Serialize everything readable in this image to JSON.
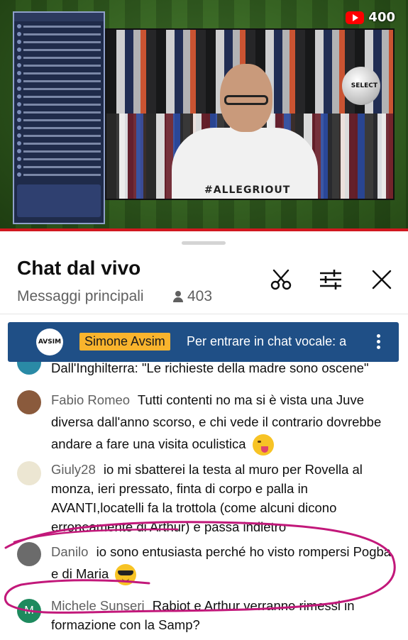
{
  "video": {
    "live_viewers_badge": "400",
    "shirt_text": "#ALLEGRIOUT",
    "ball_label": "SELECT"
  },
  "panel": {
    "title": "Chat dal vivo",
    "filter_label": "Messaggi principali",
    "viewer_count": "403",
    "icons": [
      "scissors-icon",
      "filter-sliders-icon",
      "close-icon"
    ]
  },
  "pinned": {
    "avatar_text": "AVSIM",
    "author": "Simone Avsim",
    "text": "Per entrare in chat vocale: a"
  },
  "messages": [
    {
      "author": "",
      "text": "Dall'Inghilterra: \"Le richieste della madre sono oscene\"",
      "avatar_color": "#2a8aa6"
    },
    {
      "author": "Fabio Romeo",
      "text": "Tutti contenti no ma si è vista una Juve diversa dall'anno scorso, e chi vede il contrario dovrebbe andare a fare una visita oculistica",
      "emoji": "winking-tongue-emoji",
      "avatar_color": "#8a5a3c"
    },
    {
      "author": "Giuly28",
      "text": "io mi sbatterei la testa al muro per Rovella al monza, ieri pressato, finta di corpo e palla in AVANTI,locatelli fa la trottola (come alcuni dicono erroneamente di Arthur) e passa indietro",
      "avatar_color": "#e8e0c8"
    },
    {
      "author": "Danilo",
      "text": "io sono entusiasta perché ho visto rompersi Pogba e di Maria",
      "emoji": "sunglasses-emoji",
      "avatar_color": "#6b6b6b"
    },
    {
      "author": "Michele Sunseri",
      "text": "Rabiot e Arthur verranno rimessi in formazione con la Samp?",
      "avatar_letter": "M",
      "avatar_color": "#1e8a5e"
    }
  ],
  "colors": {
    "pinned_bg": "#1f4f86",
    "author_badge_bg": "#f9b42d",
    "annotation_stroke": "#c2187a",
    "progress_red": "#d0181f"
  }
}
